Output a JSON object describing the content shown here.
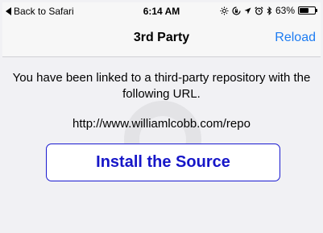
{
  "status_bar": {
    "back_label": "Back to Safari",
    "time": "6:14 AM",
    "battery_percent_label": "63%",
    "battery_level": 0.63,
    "icons": [
      "brightness-icon",
      "lock-rotation-icon",
      "location-arrow-icon",
      "alarm-icon",
      "bluetooth-icon",
      "battery-icon"
    ]
  },
  "nav": {
    "title": "3rd Party",
    "reload_label": "Reload",
    "accent_color": "#1d7cf2"
  },
  "content": {
    "message": "You have been linked to a third-party repository with the following URL.",
    "repo_url": "http://www.williamlcobb.com/repo",
    "install_button_label": "Install the Source",
    "button_color": "#1616c8"
  }
}
